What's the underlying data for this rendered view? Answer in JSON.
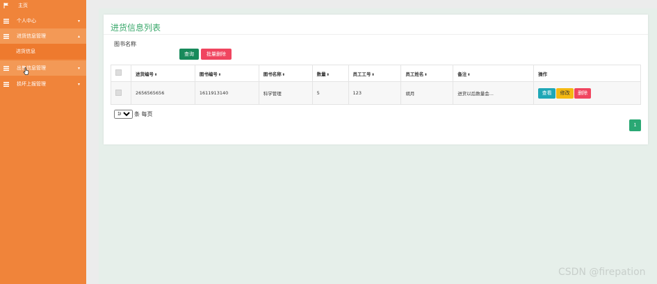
{
  "sidebar": {
    "items": [
      {
        "label": "主页",
        "icon": "flag-icon"
      },
      {
        "label": "个人中心",
        "icon": "list-icon"
      },
      {
        "label": "进货信息管理",
        "icon": "list-icon"
      },
      {
        "label": "进货信息",
        "icon": ""
      },
      {
        "label": "出售信息管理",
        "icon": "list-icon"
      },
      {
        "label": "损坏上报管理",
        "icon": "list-icon"
      }
    ]
  },
  "page": {
    "title": "进货信息列表",
    "search_label": "图书名称",
    "search_placeholder": "",
    "search_button": "查询",
    "batch_delete_button": "批量删除"
  },
  "table": {
    "headers": [
      "进货编号",
      "图书编号",
      "图书名称",
      "数量",
      "员工工号",
      "员工姓名",
      "备注",
      "操作"
    ],
    "rows": [
      {
        "purchase_no": "2656565656",
        "book_no": "1611913140",
        "book_name": "科学管理",
        "quantity": "5",
        "staff_no": "123",
        "staff_name": "胡月",
        "remark": "进货以后数量会..."
      }
    ],
    "actions": {
      "view": "查看",
      "edit": "修改",
      "delete": "删除"
    }
  },
  "pagination": {
    "page_size": "10",
    "page_size_suffix": "条 每页",
    "current_page": "1"
  },
  "watermark": "CSDN @firepation",
  "colors": {
    "sidebar": "#f0843a",
    "accent_green": "#2aa874",
    "danger": "#f0455f",
    "info": "#1fa7b6",
    "warning": "#f5b911"
  }
}
